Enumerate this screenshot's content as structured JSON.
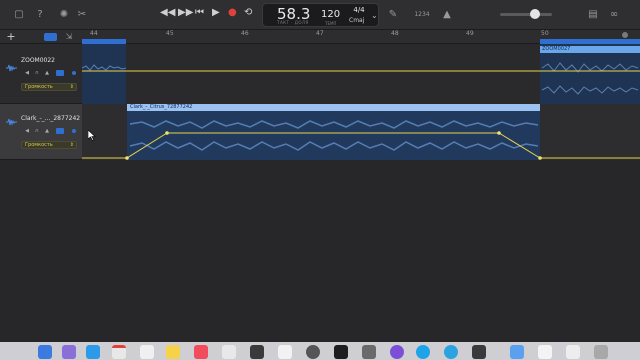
{
  "lcd": {
    "position": "58.3",
    "position_caption": "ТАКТ · ДОЛЯ",
    "tempo": "120",
    "tempo_caption": "ТЕМП",
    "time_signature": "4/4",
    "key": "Cmaj"
  },
  "toolbar": {
    "counter": "1234",
    "play": "▶",
    "record": "●"
  },
  "ruler": {
    "bars": [
      "44",
      "45",
      "46",
      "47",
      "48",
      "49",
      "50"
    ]
  },
  "tracks": [
    {
      "name": "ZOOM0022",
      "automation_param": "Громкость",
      "regions": [
        {
          "label": "ZOOM0027"
        }
      ]
    },
    {
      "name": "Clark_-_..._2877242",
      "automation_param": "Громкость",
      "regions": [
        {
          "label": "Clark_-_Citrus_72877242"
        }
      ]
    }
  ],
  "colors": {
    "region_blue": "#2f6fd2",
    "region_header": "#6aa7ea",
    "automation_line": "#e6d24a",
    "record": "#e0413a"
  }
}
